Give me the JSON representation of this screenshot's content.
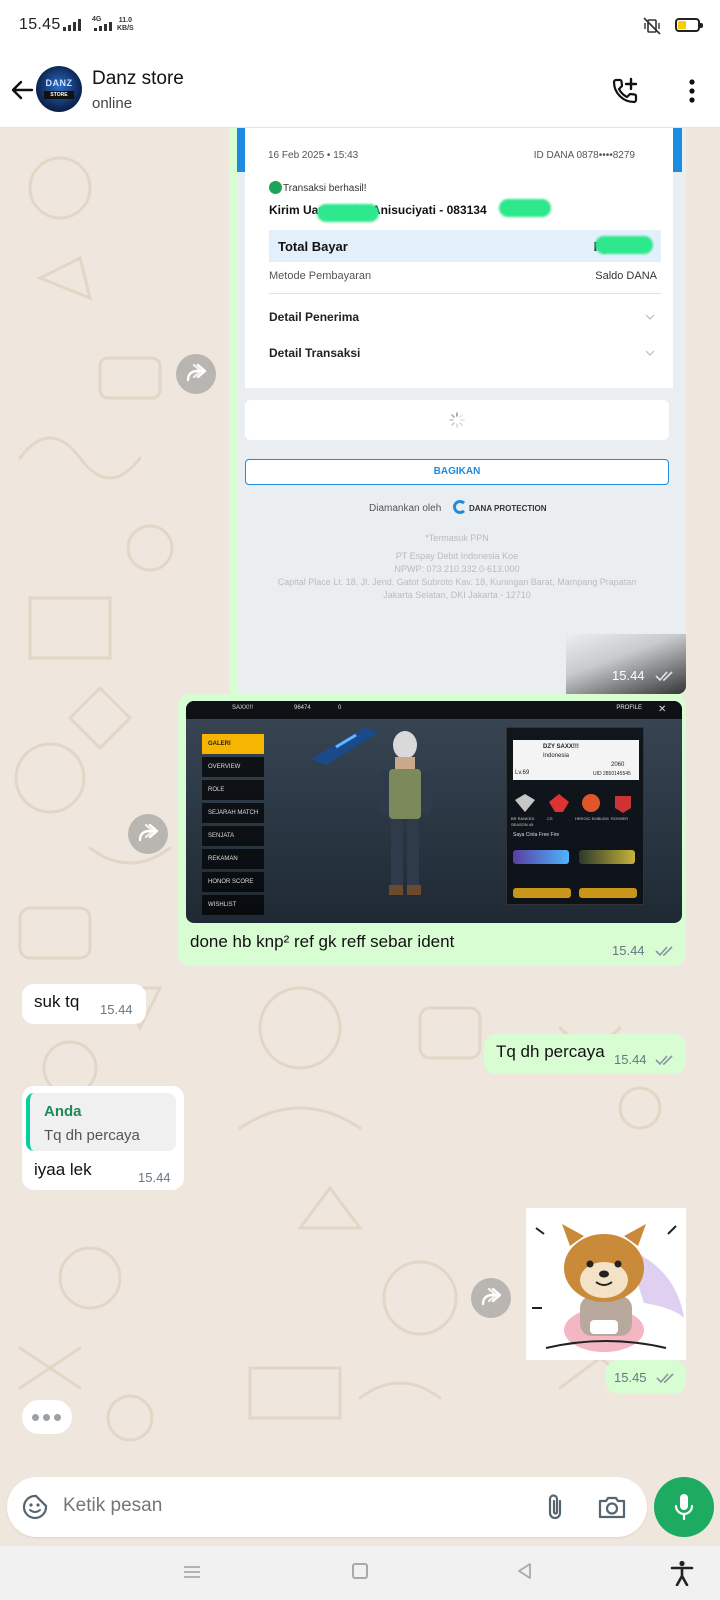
{
  "status_bar": {
    "time": "15.45",
    "network": "4G",
    "speed_value": "11.0",
    "speed_unit": "KB/S"
  },
  "header": {
    "contact_name": "Danz store",
    "contact_status": "online",
    "avatar_text": "DANZ",
    "avatar_subtext": "STORE"
  },
  "messages": {
    "receipt": {
      "date": "16 Feb 2025 • 15:43",
      "id_dana": "ID DANA 0878••••8279",
      "success": "Transaksi berhasil!",
      "send_line": "Kirim Uang Rp  ke Anisuciyati - 083134",
      "total_label": "Total Bayar",
      "total_value": "Rp",
      "method_label": "Metode Pembayaran",
      "method_value": "Saldo DANA",
      "recipient_detail": "Detail Penerima",
      "transaction_detail": "Detail Transaksi",
      "share_button": "BAGIKAN",
      "secured_by": "Diamankan oleh",
      "protection": "DANA PROTECTION",
      "footer_ppn": "*Termasuk PPN",
      "footer_company": "PT Espay Debit Indonesia Koe",
      "footer_npwp": "NPWP: 073.210.332.0-613.000",
      "footer_address1": "Capital Place Lt. 18, Jl. Jend. Gatot Subroto Kav. 18, Kuningan Barat, Mampang Prapatan",
      "footer_address2": "Jakarta Selatan, DKI Jakarta - 12710",
      "time": "15.44"
    },
    "game_image": {
      "player_name": "SAXX!!!",
      "coins": "96474",
      "diamonds": "0",
      "profile_label": "PROFILE",
      "menu": [
        "GALERI",
        "OVERVIEW",
        "ROLE",
        "SEJARAH MATCH",
        "SENJATA",
        "REKAMAN",
        "HONOR SCORE",
        "WISHLIST"
      ],
      "card_name": "DZY  SAXX!!!",
      "card_region": "Indonesia",
      "card_level": "Lv.69",
      "card_likes": "2060",
      "card_uid": "UID 2850145545",
      "badges": [
        "BR RANKED",
        "CS",
        "HEROIC EMBLEM",
        "ROSHER"
      ],
      "badge_season": "SEASON 45",
      "guns_label": "Saya Cinta Free Fire",
      "caption": "done hb knp² ref gk reff sebar ident",
      "time": "15.44"
    },
    "in_suk": {
      "text": "suk tq",
      "time": "15.44"
    },
    "out_tq": {
      "text": "Tq dh percaya",
      "time": "15.44"
    },
    "in_reply": {
      "quote_author": "Anda",
      "quote_text": "Tq dh percaya",
      "text": "iyaa lek",
      "time": "15.44"
    },
    "sticker": {
      "time": "15.45"
    }
  },
  "input": {
    "placeholder": "Ketik pesan"
  },
  "colors": {
    "outgoing_bubble": "#d9fdd3",
    "incoming_bubble": "#ffffff",
    "chat_background": "#efe7de",
    "mic_button": "#1daa61",
    "read_ticks": "#8696a0"
  },
  "icons": [
    "back-arrow-icon",
    "call-add-icon",
    "more-vert-icon",
    "forward-icon",
    "double-tick-icon",
    "sticker-icon",
    "attach-icon",
    "camera-icon",
    "mic-icon"
  ]
}
